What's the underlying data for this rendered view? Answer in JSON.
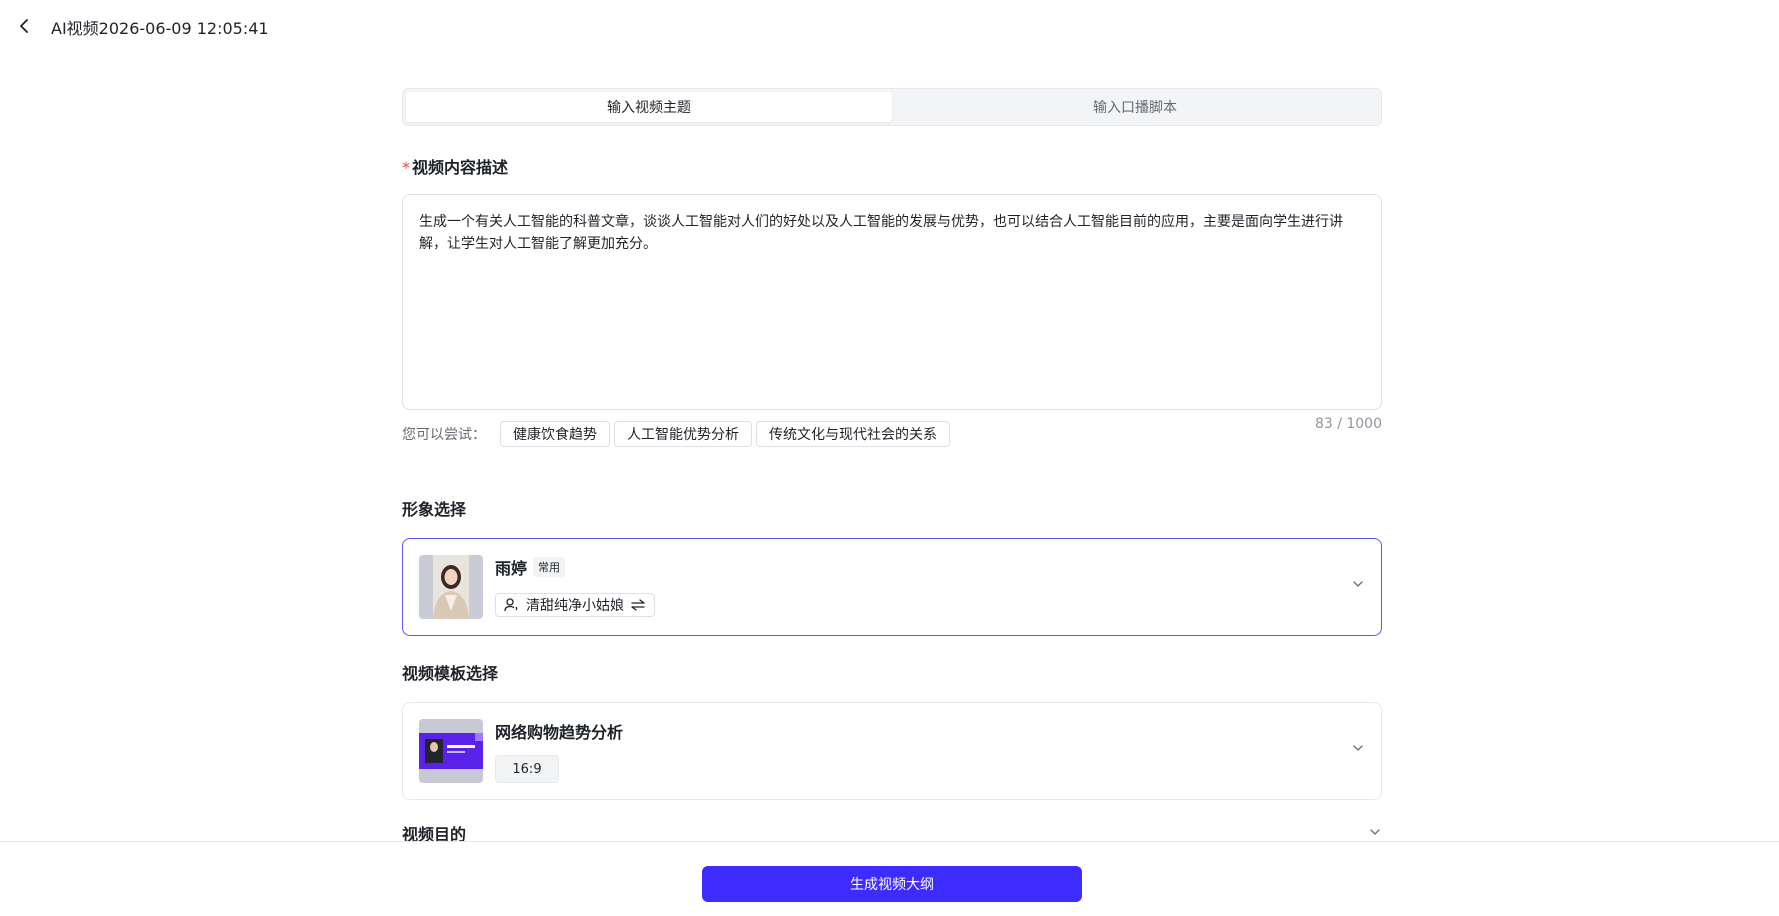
{
  "header": {
    "title": "AI视频2026-06-09 12:05:41",
    "back_icon": "chevron-left-icon"
  },
  "tabs": [
    {
      "label": "输入视频主题",
      "active": true
    },
    {
      "label": "输入口播脚本",
      "active": false
    }
  ],
  "description": {
    "label": "视频内容描述",
    "required_mark": "*",
    "value": "生成一个有关人工智能的科普文章，谈谈人工智能对人们的好处以及人工智能的发展与优势，也可以结合人工智能目前的应用，主要是面向学生进行讲解，让学生对人工智能了解更加充分。",
    "counter": "83 / 1000"
  },
  "suggestions": {
    "label": "您可以尝试：",
    "items": [
      "健康饮食趋势",
      "人工智能优势分析",
      "传统文化与现代社会的关系"
    ]
  },
  "avatar_section": {
    "label": "形象选择",
    "name": "雨婷",
    "badge": "常用",
    "voice": "清甜纯净小姑娘",
    "voice_icon": "voice-person-icon",
    "swap_icon": "swap-arrows-icon"
  },
  "template_section": {
    "label": "视频模板选择",
    "name": "网络购物趋势分析",
    "ratio": "16:9"
  },
  "purpose_section": {
    "label": "视频目的"
  },
  "footer": {
    "generate_label": "生成视频大纲"
  },
  "colors": {
    "accent": "#3d2bff",
    "selected_border": "#5b55f5",
    "required": "#f54a45"
  }
}
